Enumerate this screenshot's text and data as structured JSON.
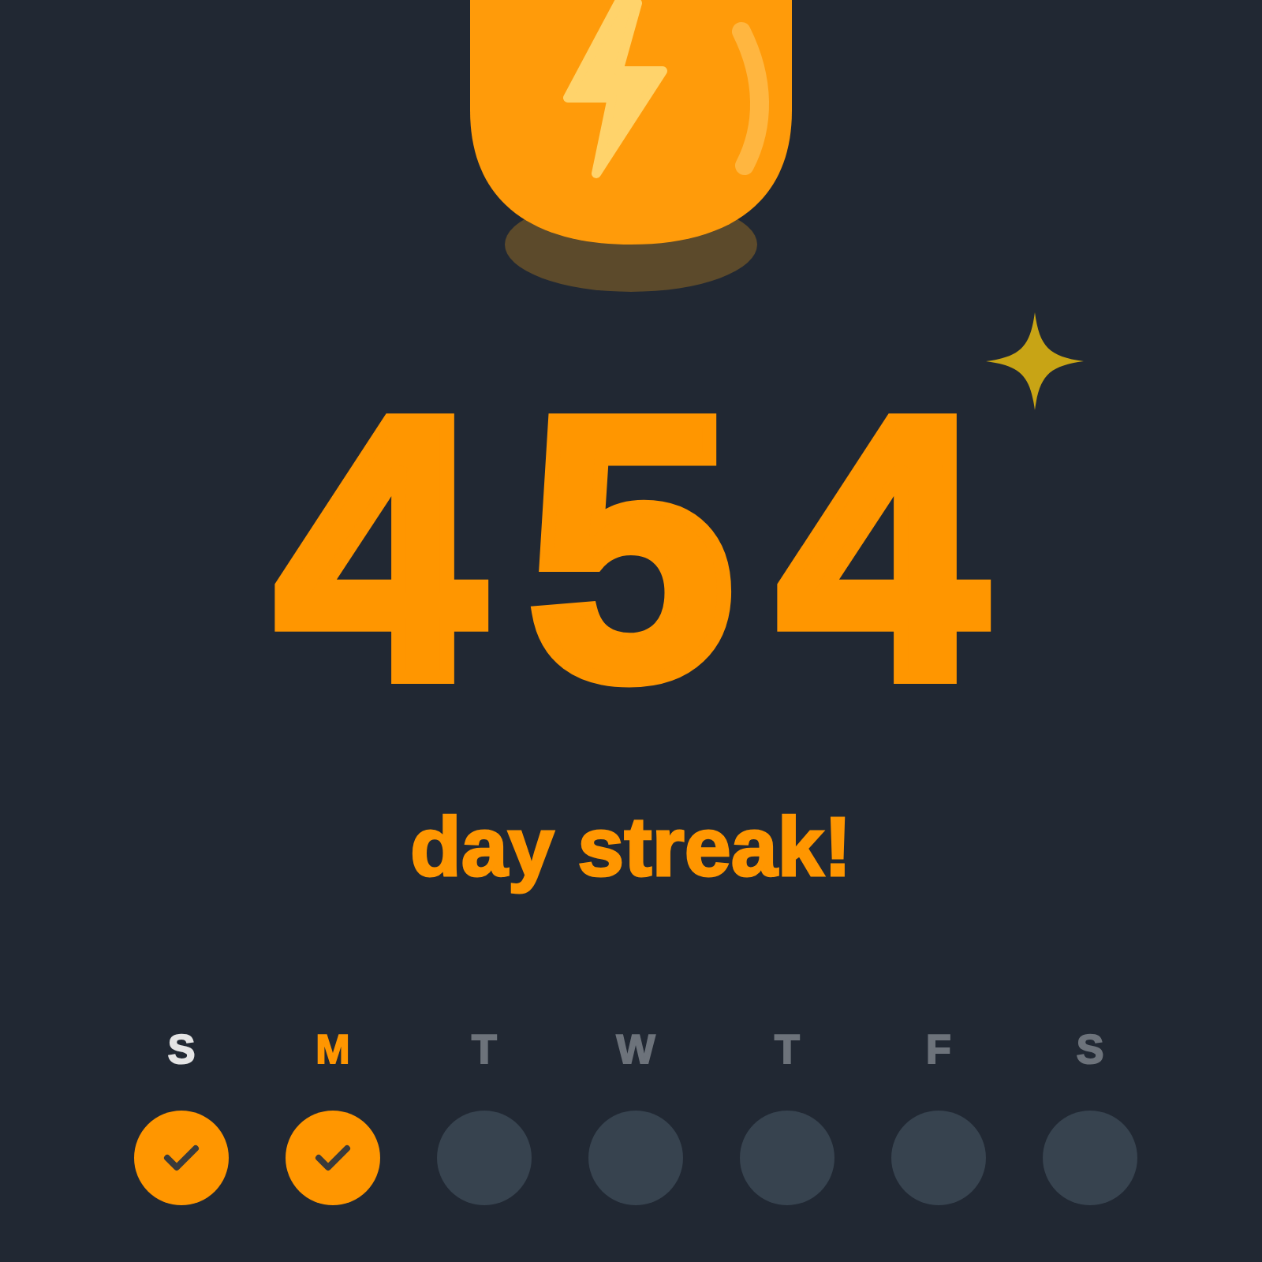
{
  "streak": {
    "count": "454",
    "label": "day streak!"
  },
  "week": [
    {
      "day": "S",
      "checked": true,
      "selected": false
    },
    {
      "day": "M",
      "checked": true,
      "selected": true
    },
    {
      "day": "T",
      "checked": false,
      "selected": false
    },
    {
      "day": "W",
      "checked": false,
      "selected": false
    },
    {
      "day": "T",
      "checked": false,
      "selected": false
    },
    {
      "day": "F",
      "checked": false,
      "selected": false
    },
    {
      "day": "S",
      "checked": false,
      "selected": false
    }
  ]
}
